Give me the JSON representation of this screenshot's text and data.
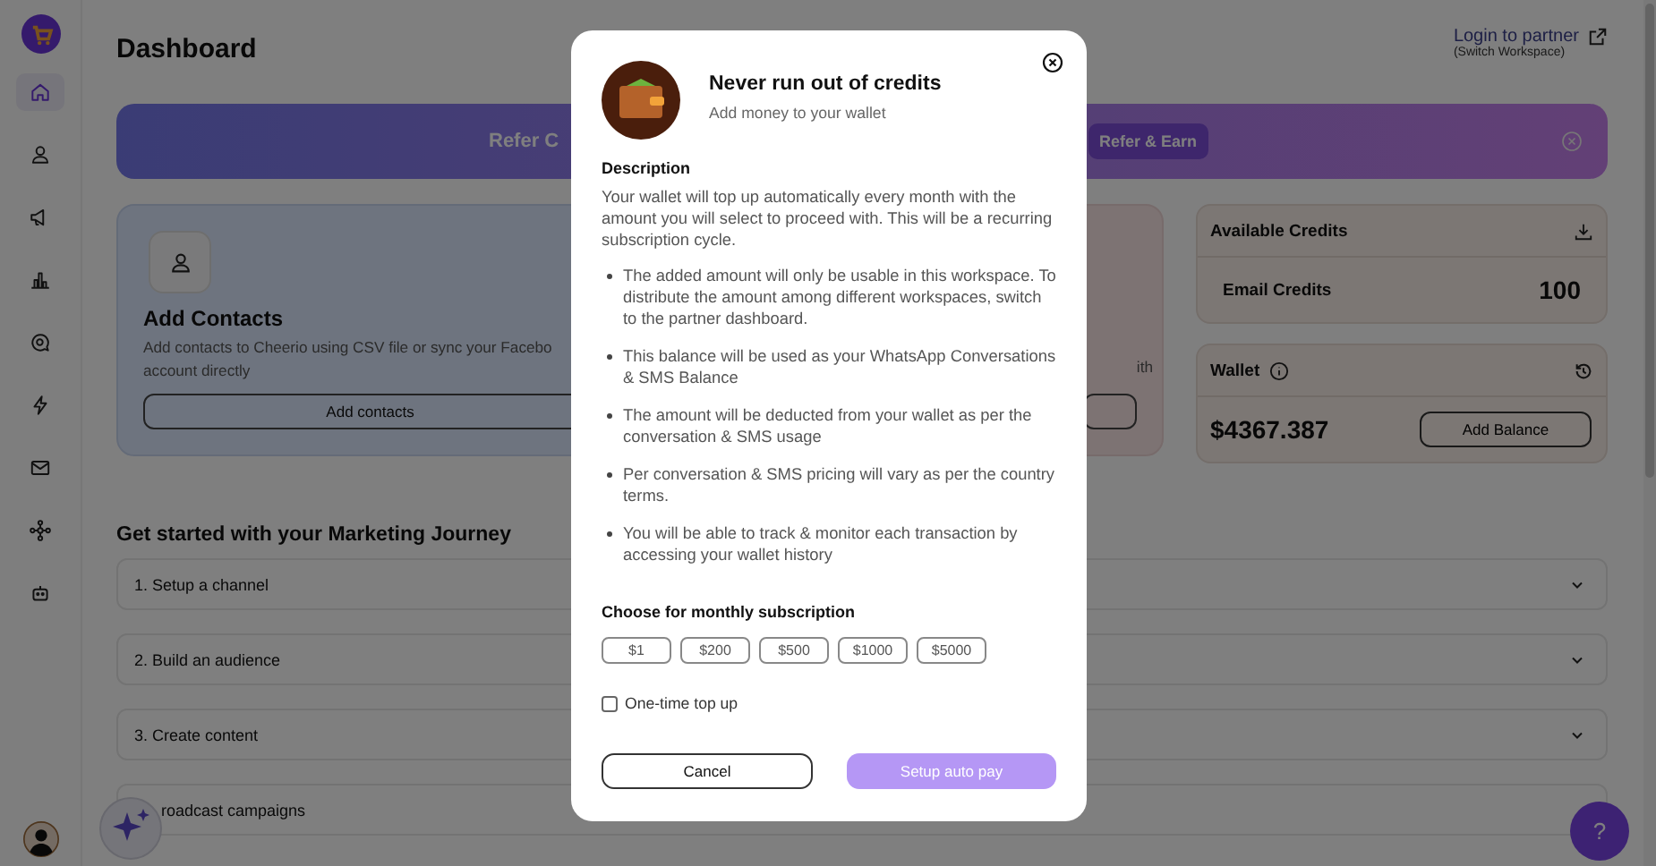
{
  "sidebar": {
    "items": [
      {
        "selected": true
      },
      {
        "selected": false
      },
      {
        "selected": false
      },
      {
        "selected": false
      },
      {
        "selected": false
      },
      {
        "selected": false
      },
      {
        "selected": false
      },
      {
        "selected": false
      },
      {
        "selected": false
      }
    ]
  },
  "header": {
    "title": "Dashboard",
    "link": "Login to partner",
    "link_note": "(Switch Workspace)"
  },
  "banner": {
    "text": "Refer C",
    "button": "Refer & Earn"
  },
  "cards": [
    {
      "kind": "full",
      "title": "Add Contacts",
      "description": [
        "Add contacts to Cheerio using CSV file or sync your Facebo",
        "account directly"
      ],
      "button": "Add contacts"
    },
    {
      "kind": "cut",
      "description": [
        "ith"
      ]
    }
  ],
  "credits": {
    "title": "Available Credits",
    "label": "Email Credits",
    "value": "100"
  },
  "wallet": {
    "title": "Wallet",
    "amount": "$4367.387",
    "button": "Add Balance"
  },
  "journey": {
    "title": "Get started with your Marketing Journey",
    "steps": [
      {
        "label": "1. Setup a channel"
      },
      {
        "label": "2. Build an audience"
      },
      {
        "label": "3. Create content"
      },
      {
        "label": "roadcast campaigns"
      }
    ]
  },
  "help_button": "?",
  "modal": {
    "title": "Never run out of credits",
    "subtitle": "Add money to your wallet",
    "description_heading": "Description",
    "description": "Your wallet will top up automatically every month with the amount you will select to proceed with. This will be a recurring subscription cycle.",
    "points": [
      "The added amount will only be usable in this workspace. To distribute the amount among different workspaces, switch to the partner dashboard.",
      "This balance will be used as your WhatsApp Conversations & SMS Balance",
      "The amount will be deducted from your wallet as per the conversation & SMS usage",
      "Per conversation & SMS pricing will vary as per the country terms.",
      "You will be able to track & monitor each transaction by accessing your wallet history"
    ],
    "choose_heading": "Choose for monthly subscription",
    "amounts": [
      {
        "label": "$1",
        "selected": false
      },
      {
        "label": "$200",
        "selected": false
      },
      {
        "label": "$500",
        "selected": false
      },
      {
        "label": "$1000",
        "selected": false
      },
      {
        "label": "$5000",
        "selected": false
      }
    ],
    "one_time": {
      "label": "One-time top up",
      "checked": false
    },
    "cancel": "Cancel",
    "confirm": {
      "label": "Setup auto pay",
      "disabled": true
    }
  }
}
